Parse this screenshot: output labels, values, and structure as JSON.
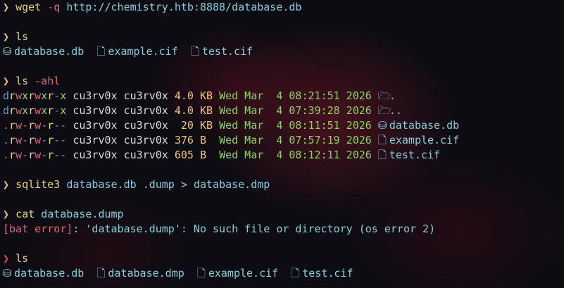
{
  "prompt_symbol": "❯",
  "blocks": {
    "wget": {
      "cmd": "wget",
      "flag": "-q",
      "arg": "http://chemistry.htb:8888/database.db"
    },
    "ls1": {
      "cmd": "ls",
      "files": [
        {
          "icon": "database-icon",
          "glyph": "⛁",
          "name": "database.db"
        },
        {
          "icon": "file-icon",
          "glyph": "🗋",
          "name": "example.cif"
        },
        {
          "icon": "file-icon",
          "glyph": "🗋",
          "name": "test.cif"
        }
      ]
    },
    "ls_ahl": {
      "cmd": "ls",
      "flag": "-ahl",
      "rows": [
        {
          "perms": "drwxrwxr-x",
          "owner": "cu3rv0x",
          "group": "cu3rv0x",
          "size": "4.0 KB",
          "date": "Wed Mar  4 08:21:51 2026",
          "icon": "folder-open-icon",
          "glyph": "🗁",
          "name": "."
        },
        {
          "perms": "drwxrwxr-x",
          "owner": "cu3rv0x",
          "group": "cu3rv0x",
          "size": "4.0 KB",
          "date": "Wed Mar  4 07:39:28 2026",
          "icon": "folder-open-icon",
          "glyph": "🗁",
          "name": ".."
        },
        {
          "perms": ".rw-rw-r--",
          "owner": "cu3rv0x",
          "group": "cu3rv0x",
          "size": " 20 KB",
          "date": "Wed Mar  4 08:11:51 2026",
          "icon": "database-icon",
          "glyph": "⛁",
          "name": "database.db"
        },
        {
          "perms": ".rw-rw-r--",
          "owner": "cu3rv0x",
          "group": "cu3rv0x",
          "size": "376 B ",
          "date": "Wed Mar  4 07:57:19 2026",
          "icon": "file-icon",
          "glyph": "🗋",
          "name": "example.cif"
        },
        {
          "perms": ".rw-rw-r--",
          "owner": "cu3rv0x",
          "group": "cu3rv0x",
          "size": "605 B ",
          "date": "Wed Mar  4 08:12:11 2026",
          "icon": "file-icon",
          "glyph": "🗋",
          "name": "test.cif"
        }
      ]
    },
    "sqlite": {
      "cmd": "sqlite3",
      "arg1": "database.db",
      "arg2": ".dump",
      "op": ">",
      "arg3": "database.dmp"
    },
    "cat": {
      "cmd": "cat",
      "arg": "database.dump",
      "error_label": "[bat error]",
      "error_text": ": 'database.dump': No such file or directory (os error 2)"
    },
    "ls2": {
      "cmd": "ls",
      "files": [
        {
          "icon": "database-icon",
          "glyph": "⛁",
          "name": "database.db"
        },
        {
          "icon": "file-icon",
          "glyph": "🗋",
          "name": "database.dmp"
        },
        {
          "icon": "file-icon",
          "glyph": "🗋",
          "name": "example.cif"
        },
        {
          "icon": "file-icon",
          "glyph": "🗋",
          "name": "test.cif"
        }
      ]
    }
  },
  "colors": {
    "prompt": "#f6c177",
    "prompt_error": "#e8475a",
    "command": "#e9d56a",
    "flag": "#e0607e",
    "argument": "#7fd0e0",
    "date": "#8bd45c",
    "size": "#f6c177"
  }
}
